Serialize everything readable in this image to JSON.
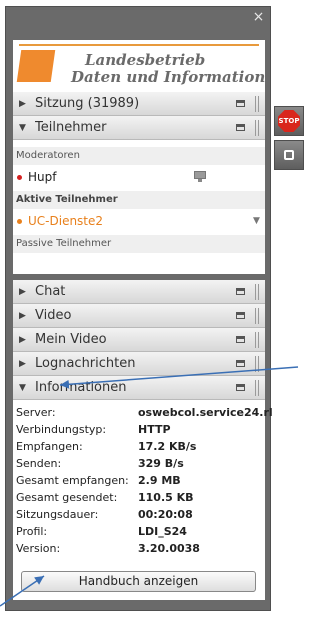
{
  "logo": {
    "line1": "Landesbetrieb",
    "line2": "Daten und Information"
  },
  "close_symbol": "×",
  "sections": {
    "sitzung": {
      "label": "Sitzung (31989)",
      "arrow": "▶"
    },
    "teilnehmer": {
      "label": "Teilnehmer",
      "arrow": "▼"
    },
    "chat": {
      "label": "Chat",
      "arrow": "▶"
    },
    "video": {
      "label": "Video",
      "arrow": "▶"
    },
    "mein_video": {
      "label": "Mein Video",
      "arrow": "▶"
    },
    "lognachrichten": {
      "label": "Lognachrichten",
      "arrow": "▶"
    },
    "informationen": {
      "label": "Informationen",
      "arrow": "▼"
    }
  },
  "participants": {
    "moderators_header": "Moderatoren",
    "moderator": {
      "name": "Hupf",
      "color": "#d42020"
    },
    "active_header": "Aktive Teilnehmer",
    "active": {
      "name": "UC-Dienste2",
      "color": "#e8801c"
    },
    "passive_header": "Passive Teilnehmer"
  },
  "info": [
    {
      "key": "Server:",
      "value": "oswebcol.service24.rl"
    },
    {
      "key": "Verbindungstyp:",
      "value": "HTTP"
    },
    {
      "key": "Empfangen:",
      "value": "17.2 KB/s"
    },
    {
      "key": "Senden:",
      "value": "329 B/s"
    },
    {
      "key": "Gesamt empfangen:",
      "value": "2.9 MB"
    },
    {
      "key": "Gesamt gesendet:",
      "value": "110.5 KB"
    },
    {
      "key": "Sitzungsdauer:",
      "value": "00:20:08"
    },
    {
      "key": "Profil:",
      "value": "LDI_S24"
    },
    {
      "key": "Version:",
      "value": "3.20.0038"
    }
  ],
  "manual_button": "Handbuch anzeigen",
  "side_stop_label": "STOP",
  "icons": [
    "close-icon",
    "expand-arrow-icon",
    "collapse-arrow-icon",
    "minimize-icon",
    "grip-icon",
    "monitor-icon",
    "dropdown-icon",
    "stop-icon",
    "square-icon"
  ],
  "colors": {
    "accent": "#ef8a2e",
    "panel": "#6a6a6a",
    "annotation": "#3a6fb5"
  }
}
